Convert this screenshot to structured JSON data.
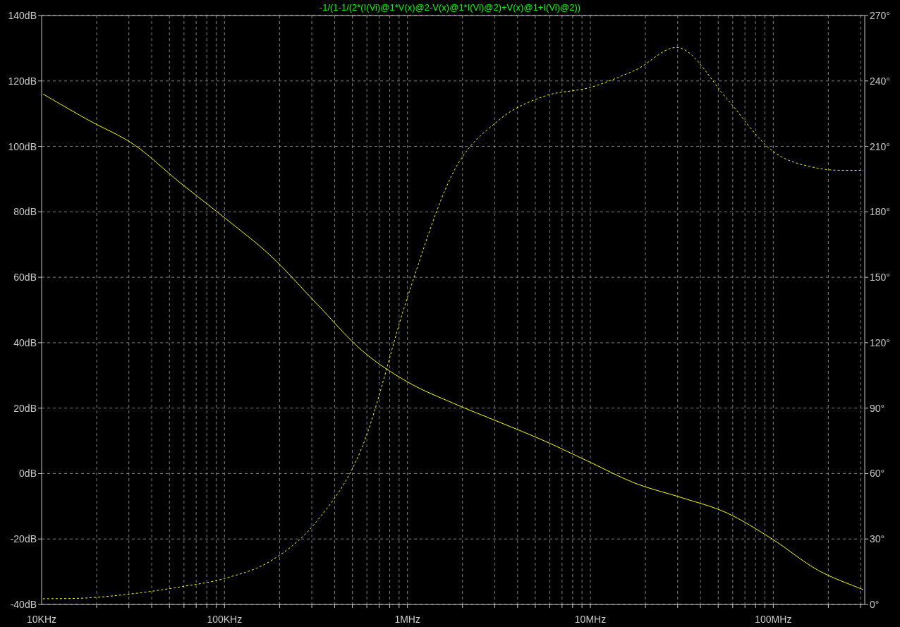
{
  "chart_data": {
    "type": "line",
    "title": "-1/(1-1/(2*(I(Vi)@1*V(x)@2-V(x)@1*I(Vi)@2)+V(x)@1+I(Vi)@2))",
    "grid": true,
    "categories": [
      "10KHz",
      null,
      null,
      null,
      "100KHz",
      null,
      null,
      null,
      "1MHz",
      null,
      null,
      null,
      "10MHz",
      null,
      null,
      null,
      "100MHz",
      null,
      null
    ],
    "ylim": [
      -40,
      140
    ],
    "yticks": [
      {
        "value": 140,
        "label": "140dB"
      },
      {
        "value": 120,
        "label": "120dB"
      },
      {
        "value": 100,
        "label": "100dB"
      },
      {
        "value": 80,
        "label": "80dB"
      },
      {
        "value": 60,
        "label": "60dB"
      },
      {
        "value": 40,
        "label": "40dB"
      },
      {
        "value": 20,
        "label": "20dB"
      },
      {
        "value": 0,
        "label": "0dB"
      },
      {
        "value": -20,
        "label": "-20dB"
      },
      {
        "value": -40,
        "label": "-40dB"
      }
    ],
    "y2lim": [
      0,
      270
    ],
    "y2ticks": [
      {
        "value": 270,
        "label": "270°"
      },
      {
        "value": 240,
        "label": "240°"
      },
      {
        "value": 210,
        "label": "210°"
      },
      {
        "value": 180,
        "label": "180°"
      },
      {
        "value": 150,
        "label": "150°"
      },
      {
        "value": 120,
        "label": "120°"
      },
      {
        "value": 90,
        "label": "90°"
      },
      {
        "value": 60,
        "label": "60°"
      },
      {
        "value": 30,
        "label": "30°"
      },
      {
        "value": 0,
        "label": "0°"
      }
    ],
    "series": [
      {
        "color": "#ffff00",
        "line_style": "solid",
        "values": [
          116,
          108,
          100.5,
          89,
          78,
          66.5,
          52,
          37.6,
          28,
          21.5,
          15.8,
          10,
          3.5,
          -3,
          -7.3,
          -12,
          -20,
          -29.5,
          -35.5
        ]
      },
      {
        "axis": "y2",
        "color": "#ffff00",
        "line_style": "dashed",
        "values": [
          2.6,
          3,
          5,
          8,
          12,
          20,
          38,
          72,
          141,
          198,
          222,
          233,
          237,
          245,
          255,
          232,
          208,
          200,
          199
        ]
      }
    ]
  }
}
